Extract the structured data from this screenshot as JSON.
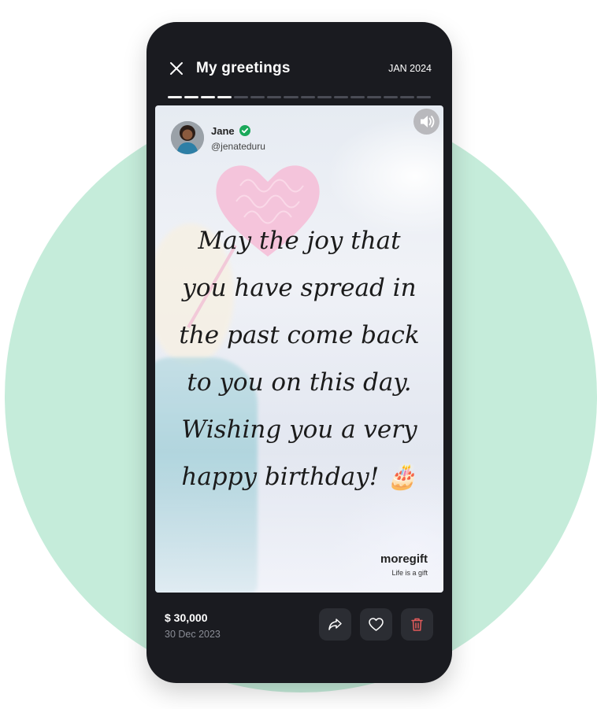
{
  "header": {
    "title": "My greetings",
    "period": "JAN 2024",
    "progress": {
      "segments": 16,
      "completed": 4
    }
  },
  "sender": {
    "name": "Jane",
    "handle": "@jenateduru",
    "verified": true
  },
  "greeting": {
    "lines": [
      "May the joy that",
      "you have spread in",
      "the past come back",
      "to you on this day.",
      "Wishing you a very",
      "happy birthday! 🎂"
    ]
  },
  "brand": {
    "name": "moregift",
    "tagline": "Life is a gift"
  },
  "gift": {
    "amount": "$ 30,000",
    "date": "30 Dec 2023"
  },
  "icons": {
    "close": "close-icon",
    "sound": "speaker-icon",
    "share": "share-icon",
    "like": "heart-icon",
    "delete": "trash-icon"
  },
  "colors": {
    "phone_bg": "#1a1b20",
    "backdrop_circle": "#c5ecda",
    "action_bg": "#2b2d33",
    "delete_accent": "#e25b5b",
    "verified": "#1aa85a"
  }
}
